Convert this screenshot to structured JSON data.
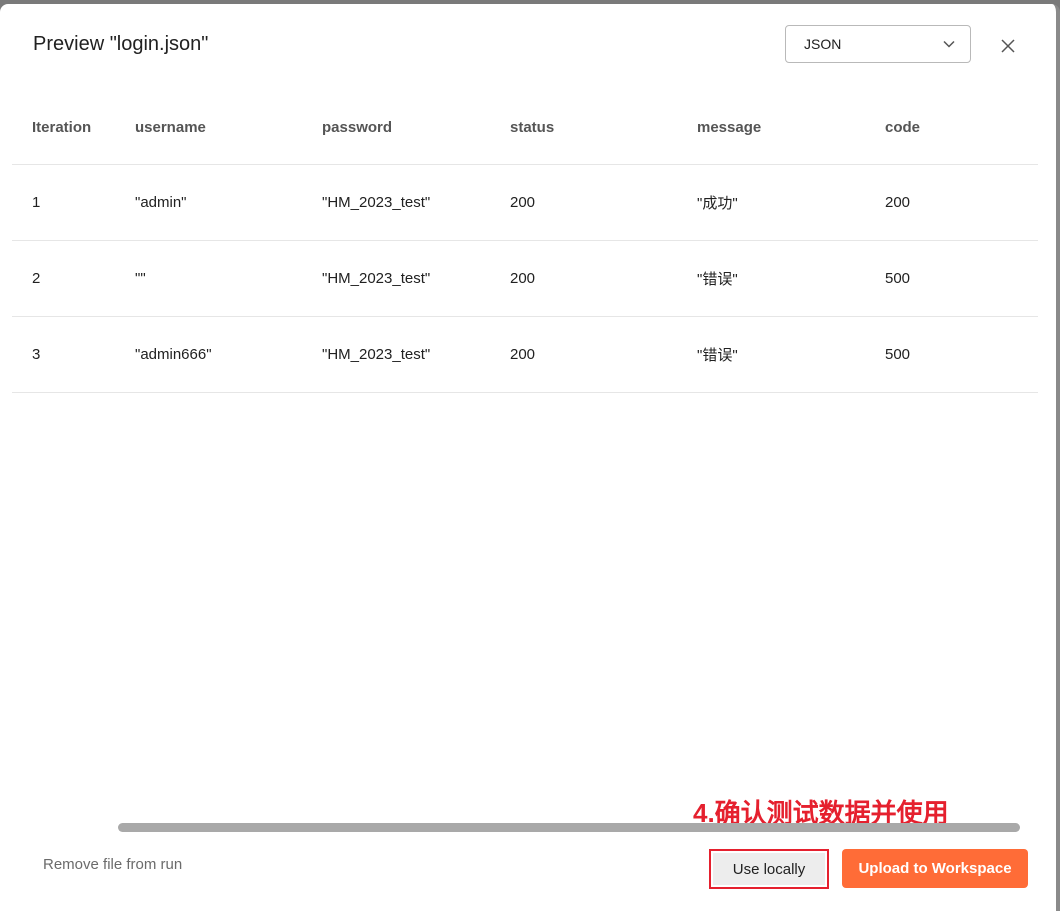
{
  "dialog": {
    "title": "Preview \"login.json\"",
    "format_select": {
      "value": "JSON",
      "icon": "chevron-down-icon"
    },
    "close_icon": "close-icon"
  },
  "table": {
    "columns": [
      "Iteration",
      "username",
      "password",
      "status",
      "message",
      "code"
    ],
    "rows": [
      [
        "1",
        "\"admin\"",
        "\"HM_2023_test\"",
        "200",
        "\"成功\"",
        "200"
      ],
      [
        "2",
        "\"\"",
        "\"HM_2023_test\"",
        "200",
        "\"错误\"",
        "500"
      ],
      [
        "3",
        "\"admin666\"",
        "\"HM_2023_test\"",
        "200",
        "\"错误\"",
        "500"
      ]
    ]
  },
  "annotation": "4.确认测试数据并使用",
  "footer": {
    "remove_label": "Remove file from run",
    "use_locally_label": "Use locally",
    "upload_label": "Upload to Workspace"
  },
  "colors": {
    "accent": "#ff6c37",
    "annotation_red": "#e5202e"
  }
}
